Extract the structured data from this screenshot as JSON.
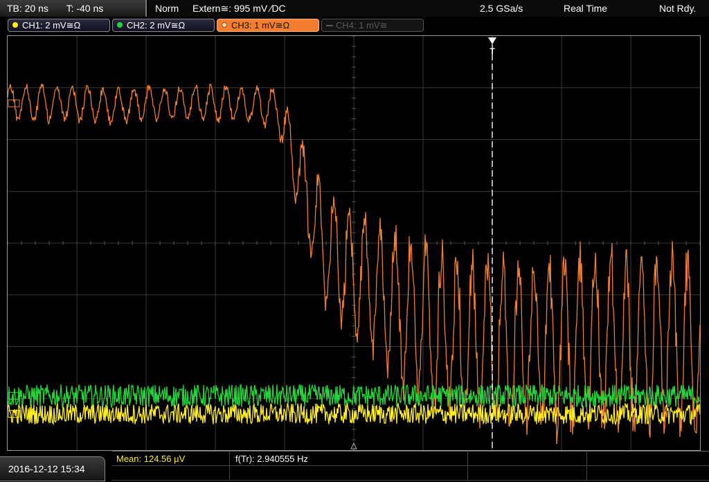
{
  "status": {
    "timebase": "TB: 20 ns",
    "trigger_time": "T: -40 ns",
    "mode": "Norm",
    "trigger_source": "Extern≅: 995 mV ∕DC",
    "sample_rate": "2.5 GSa/s",
    "acquisition": "Real Time",
    "ready_state": "Not Rdy."
  },
  "channels": [
    {
      "label": "CH1: 2 mV≅Ω",
      "color": "#ffee22",
      "state": "on"
    },
    {
      "label": "CH2: 2 mV≅Ω",
      "color": "#22d63a",
      "state": "on"
    },
    {
      "label": "CH3: 1 mV≅Ω",
      "color": "#f07e2e",
      "state": "selected"
    },
    {
      "label": "CH4: 1 mV≅",
      "color": "#5a5a5a",
      "state": "off"
    }
  ],
  "trigger_marker": "T",
  "measurements": {
    "mean": "Mean: 124.56 µV",
    "freq": "f(Tr): 2.940555 Hz"
  },
  "datetime": "2016-12-12 15:34",
  "chart_data": {
    "type": "line",
    "grid": true,
    "grid_divisions": {
      "x": 10,
      "y": 8
    },
    "x_units": "divisions",
    "y_units": "divisions (top = 4, bottom = -4)",
    "ylim": [
      -4,
      4
    ],
    "xlim": [
      0,
      10
    ],
    "trigger_x_div": 7.0,
    "series": [
      {
        "color": "#f07e2e",
        "x": [
          0,
          0.5,
          1,
          1.5,
          2,
          2.5,
          3,
          3.5,
          3.9,
          4.1,
          4.3,
          4.6,
          5.0,
          5.4,
          5.8,
          6.2,
          6.6,
          7.0,
          7.5,
          8.0,
          8.5,
          9.0,
          9.5,
          10.0
        ],
        "mean": [
          2.7,
          2.7,
          2.7,
          2.65,
          2.7,
          2.7,
          2.7,
          2.7,
          2.6,
          1.8,
          0.9,
          -0.1,
          -0.6,
          -1.0,
          -1.4,
          -1.7,
          -1.9,
          -1.9,
          -1.95,
          -1.9,
          -1.95,
          -1.9,
          -1.9,
          -2.0
        ],
        "amplitude": [
          0.4,
          0.4,
          0.4,
          0.4,
          0.4,
          0.4,
          0.4,
          0.4,
          0.5,
          0.8,
          1.1,
          1.3,
          1.4,
          1.6,
          1.8,
          1.85,
          1.9,
          1.95,
          1.95,
          2.0,
          2.0,
          2.0,
          2.0,
          2.0
        ]
      },
      {
        "color": "#22d63a",
        "x": [
          0,
          10
        ],
        "mean": [
          -2.95,
          -2.95
        ],
        "amplitude": [
          0.22,
          0.22
        ]
      },
      {
        "color": "#ffee22",
        "x": [
          0,
          10
        ],
        "mean": [
          -3.3,
          -3.3
        ],
        "amplitude": [
          0.2,
          0.2
        ]
      }
    ]
  }
}
